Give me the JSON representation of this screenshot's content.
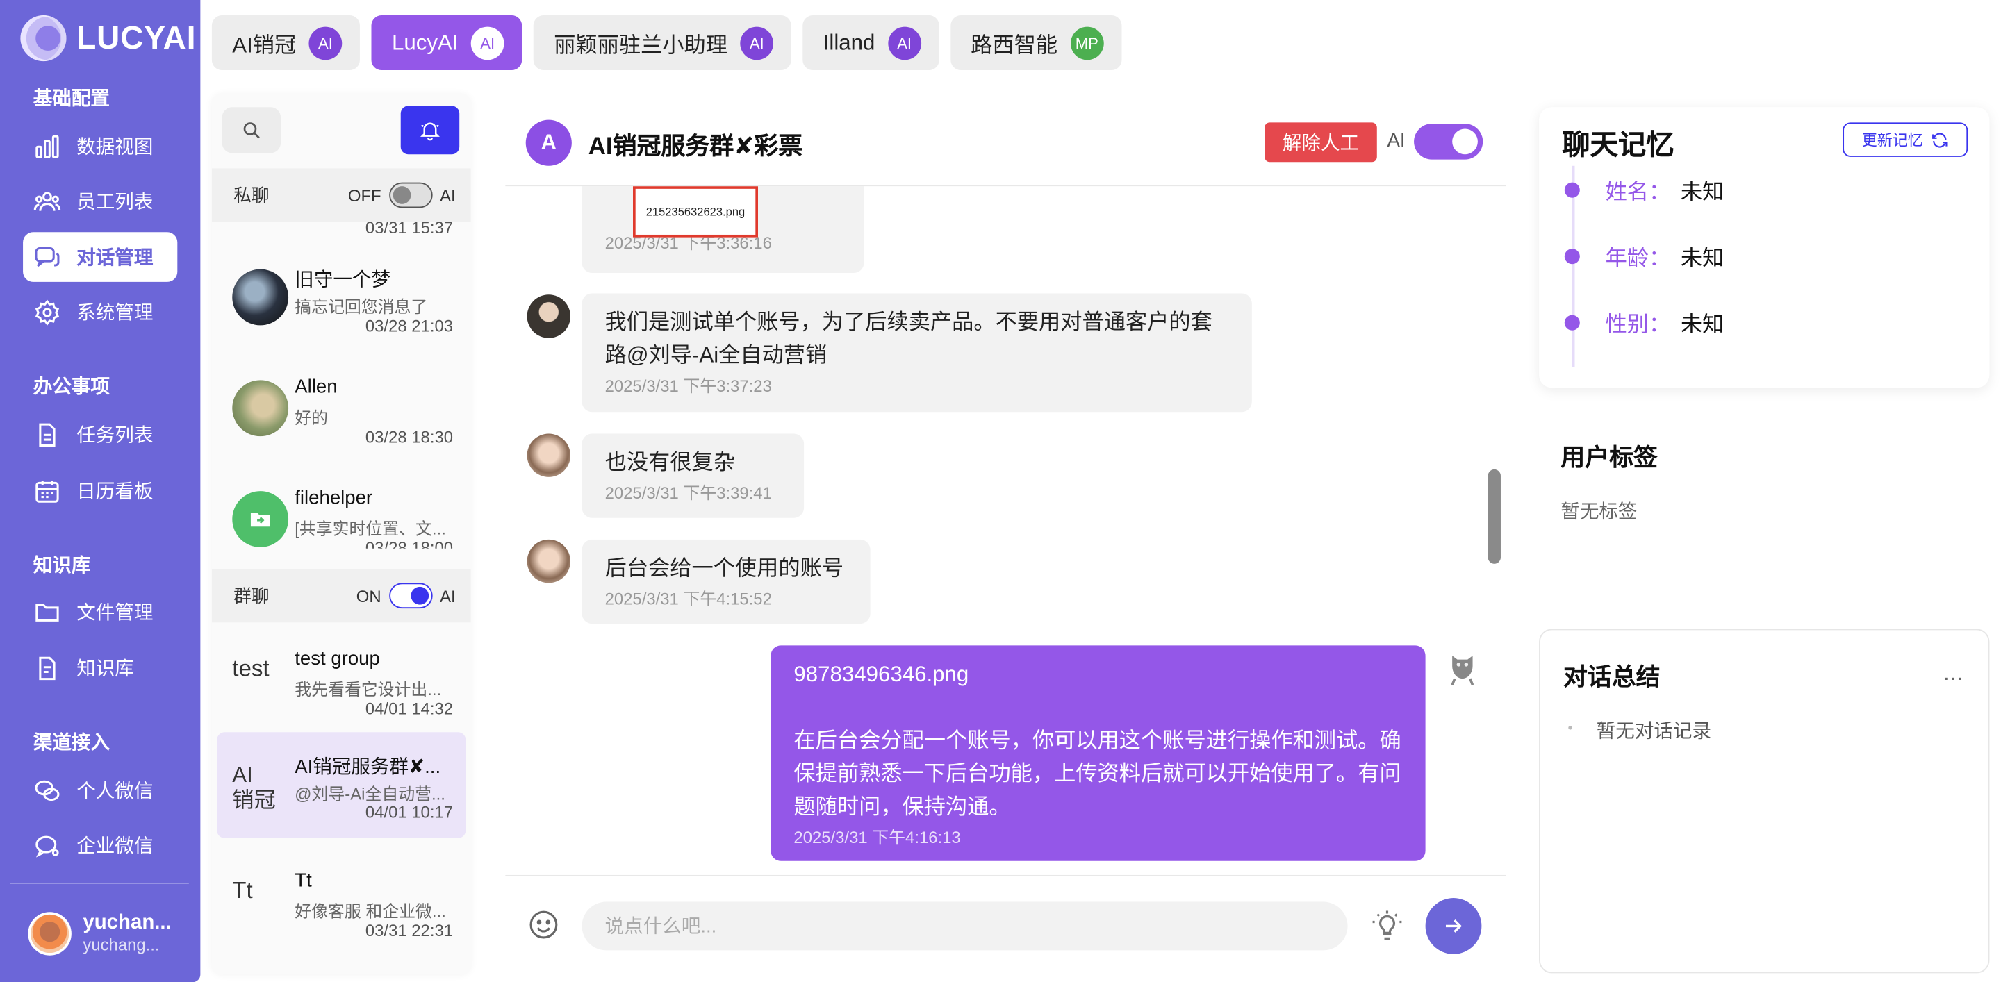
{
  "brand": {
    "name": "LUCYAI"
  },
  "sidebar": {
    "sections": [
      {
        "title": "基础配置"
      },
      {
        "title": "办公事项"
      },
      {
        "title": "知识库"
      },
      {
        "title": "渠道接入"
      }
    ],
    "items": [
      {
        "label": "数据视图",
        "icon": "bar-chart-icon"
      },
      {
        "label": "员工列表",
        "icon": "users-icon"
      },
      {
        "label": "对话管理",
        "icon": "chat-icon",
        "active": true
      },
      {
        "label": "系统管理",
        "icon": "gear-icon"
      },
      {
        "label": "任务列表",
        "icon": "document-icon"
      },
      {
        "label": "日历看板",
        "icon": "calendar-icon"
      },
      {
        "label": "文件管理",
        "icon": "folder-icon"
      },
      {
        "label": "知识库",
        "icon": "book-icon"
      },
      {
        "label": "个人微信",
        "icon": "wechat-icon"
      },
      {
        "label": "企业微信",
        "icon": "work-wechat-icon"
      }
    ],
    "user": {
      "name": "yuchan...",
      "sub": "yuchang..."
    }
  },
  "tabs": [
    {
      "label": "AI销冠",
      "badge": "AI"
    },
    {
      "label": "LucyAI",
      "badge": "AI",
      "active": true
    },
    {
      "label": "丽颖丽驻兰小助理",
      "badge": "AI"
    },
    {
      "label": "Illand",
      "badge": "AI"
    },
    {
      "label": "路西智能",
      "badge": "MP"
    }
  ],
  "convlist": {
    "private_header": {
      "title": "私聊",
      "state": "OFF",
      "ai": "AI"
    },
    "group_header": {
      "title": "群聊",
      "state": "ON",
      "ai": "AI"
    },
    "partial_time": "03/31 15:37",
    "private": [
      {
        "name": "旧守一个梦",
        "preview": "搞忘记回您消息了",
        "time": "03/28 21:03"
      },
      {
        "name": "Allen",
        "preview": "好的",
        "time": "03/28 18:30"
      },
      {
        "name": "filehelper",
        "preview": "[共享实时位置、文...",
        "time": "03/28 18:00"
      }
    ],
    "groups": [
      {
        "name": "test group",
        "preview": "我先看看它设计出...",
        "time": "04/01 14:32",
        "alt": "test"
      },
      {
        "name": "AI销冠服务群✘...",
        "preview": "@刘导-Ai全自动营...",
        "time": "04/01 10:17",
        "alt": "AI 销冠",
        "selected": true
      },
      {
        "name": "Tt",
        "preview": "好像客服 和企业微...",
        "time": "03/31 22:31",
        "alt": "Tt"
      }
    ]
  },
  "chat": {
    "avatar_letter": "A",
    "title": "AI销冠服务群✘彩票",
    "release_label": "解除人工",
    "ai_label": "AI",
    "image_filename": "215235632623.png",
    "messages": [
      {
        "text": "",
        "time": "2025/3/31 下午3:36:16"
      },
      {
        "text": "我们是测试单个账号，为了后续卖产品。不要用对普通客户的套路@刘导-Ai全自动营销",
        "time": "2025/3/31 下午3:37:23"
      },
      {
        "text": "也没有很复杂",
        "time": "2025/3/31 下午3:39:41"
      },
      {
        "text": "后台会给一个使用的账号",
        "time": "2025/3/31 下午4:15:52"
      },
      {
        "file": "98783496346.png",
        "text": "在后台会分配一个账号，你可以用这个账号进行操作和测试。确保提前熟悉一下后台功能，上传资料后就可以开始使用了。有问题随时问，保持沟通。",
        "time": "2025/3/31 下午4:16:13"
      }
    ],
    "input_placeholder": "说点什么吧..."
  },
  "memory": {
    "title": "聊天记忆",
    "update_label": "更新记忆",
    "fields": [
      {
        "key": "姓名：",
        "value": "未知"
      },
      {
        "key": "年龄：",
        "value": "未知"
      },
      {
        "key": "性别：",
        "value": "未知"
      }
    ]
  },
  "tags": {
    "title": "用户标签",
    "empty": "暂无标签"
  },
  "summary": {
    "title": "对话总结",
    "more": "...",
    "empty": "暂无对话记录"
  },
  "colors": {
    "sidebar": "#6c66d8",
    "accent": "#9457e8",
    "primary": "#3a35ee",
    "danger": "#e5484d"
  }
}
